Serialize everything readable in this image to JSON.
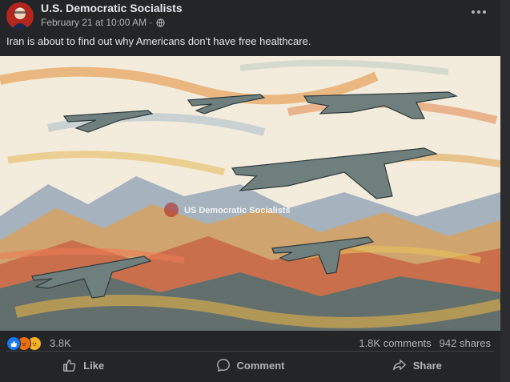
{
  "post": {
    "page_name": "U.S. Democratic Socialists",
    "timestamp": "February 21 at 10:00 AM",
    "separator": "·",
    "audience_icon": "globe-icon",
    "more_icon": "more-options-icon",
    "caption": "Iran is about to find out why Americans don't have free healthcare.",
    "image": {
      "watermark": "US Democratic Socialists",
      "subject": "watercolor-fighter-jets-and-bombers"
    }
  },
  "stats": {
    "reactions": [
      "like-reaction-icon",
      "angry-reaction-icon",
      "sad-reaction-icon"
    ],
    "reaction_count": "3.8K",
    "comments": "1.8K comments",
    "shares": "942 shares"
  },
  "actions": {
    "like": "Like",
    "comment": "Comment",
    "share": "Share"
  },
  "colors": {
    "background": "#242526",
    "text": "#e4e6eb",
    "muted": "#b0b3b8",
    "brand": "#1877f2"
  }
}
